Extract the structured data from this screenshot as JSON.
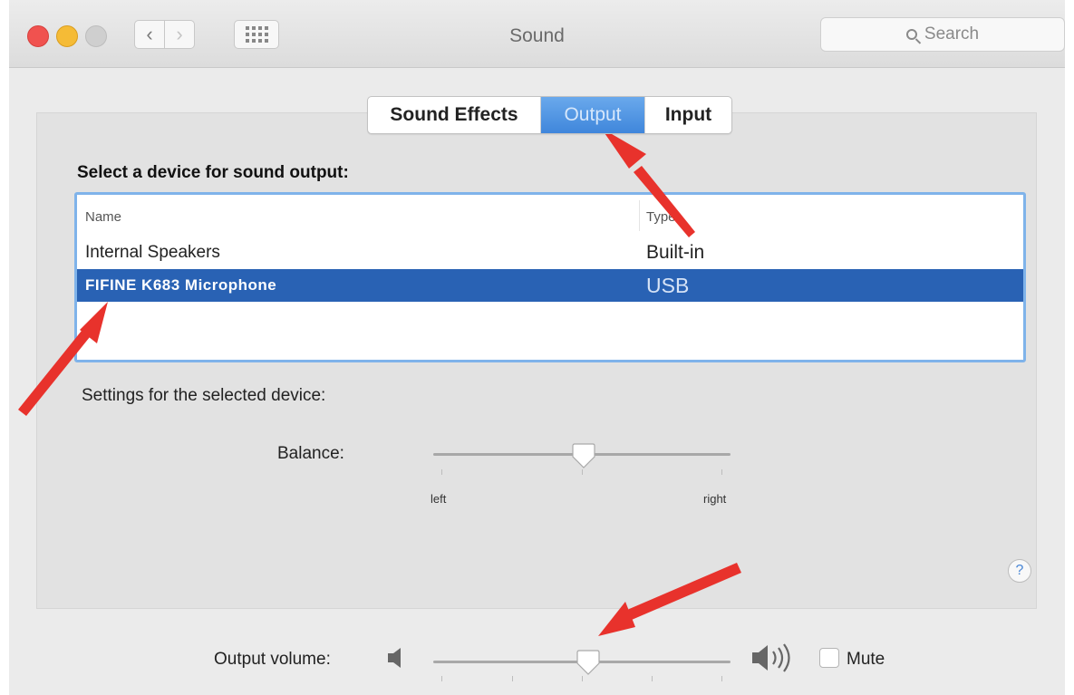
{
  "window": {
    "title": "Sound",
    "search_placeholder": "Search"
  },
  "toolbar": {
    "back_icon": "chevron-left-icon",
    "forward_icon": "chevron-right-icon",
    "show_all_icon": "grid-icon"
  },
  "tabs": [
    {
      "label": "Sound Effects",
      "selected": false
    },
    {
      "label": "Output",
      "selected": true
    },
    {
      "label": "Input",
      "selected": false
    }
  ],
  "output": {
    "select_label": "Select a device for sound output:",
    "columns": {
      "name": "Name",
      "type": "Type"
    },
    "devices": [
      {
        "name": "Internal Speakers",
        "type": "Built-in",
        "selected": false
      },
      {
        "name": "FIFINE  K683  Microphone",
        "type": "USB",
        "selected": true
      }
    ],
    "settings_label": "Settings for the selected device:",
    "balance": {
      "label": "Balance:",
      "left_label": "left",
      "right_label": "right",
      "value": 0.5
    }
  },
  "help": {
    "label": "?"
  },
  "volume": {
    "label": "Output volume:",
    "value": 0.5,
    "mute_label": "Mute",
    "muted": false
  },
  "colors": {
    "selection_blue": "#2962b4",
    "tab_selected": "#3f86db",
    "annotation_red": "#e8322c"
  }
}
